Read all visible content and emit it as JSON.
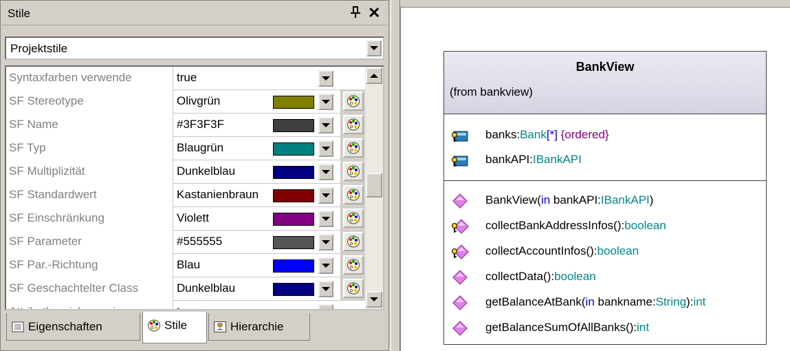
{
  "panel": {
    "title": "Stile",
    "pin_glyph": "Ԃ",
    "close_glyph": "✕",
    "style_scope": "Projektstile"
  },
  "properties": [
    {
      "name": "Syntaxfarben verwende",
      "value": "true",
      "color": null
    },
    {
      "name": "SF Stereotype",
      "value": "Olivgrün",
      "color": "#808000"
    },
    {
      "name": "SF Name",
      "value": "#3F3F3F",
      "color": "#3f3f3f"
    },
    {
      "name": "SF Typ",
      "value": "Blaugrün",
      "color": "#008080"
    },
    {
      "name": "SF Multiplizität",
      "value": "Dunkelblau",
      "color": "#000080"
    },
    {
      "name": "SF Standardwert",
      "value": "Kastanienbraun",
      "color": "#800000"
    },
    {
      "name": "SF Einschränkung",
      "value": "Violett",
      "color": "#800080"
    },
    {
      "name": "SF Parameter",
      "value": "#555555",
      "color": "#555555"
    },
    {
      "name": "SF Par.-Richtung",
      "value": "Blau",
      "color": "#0000ff"
    },
    {
      "name": "SF Geschachtelter Class",
      "value": "Dunkelblau",
      "color": "#000080"
    },
    {
      "name": "Attributbereich anzeigen",
      "value": "true",
      "color": null
    }
  ],
  "tabs": [
    {
      "label": "Eigenschaften",
      "icon": "properties-icon",
      "active": false
    },
    {
      "label": "Stile",
      "icon": "palette-icon",
      "active": true
    },
    {
      "label": "Hierarchie",
      "icon": "hierarchy-icon",
      "active": false
    }
  ],
  "diagram": {
    "class_name": "BankView",
    "from_text": "(from bankview)",
    "attributes": [
      {
        "icon": "protected-attribute-icon",
        "parts": [
          [
            "banks:",
            ""
          ],
          [
            "Bank",
            "ty"
          ],
          [
            "[*]",
            "kw"
          ],
          [
            "  {ordered}",
            "co"
          ]
        ]
      },
      {
        "icon": "protected-attribute-icon",
        "parts": [
          [
            "bankAPI:",
            ""
          ],
          [
            "IBankAPI",
            "ty"
          ]
        ]
      }
    ],
    "operations": [
      {
        "icon": "public-operation-icon",
        "parts": [
          [
            "BankView(",
            ""
          ],
          [
            "in",
            "kw"
          ],
          [
            " bankAPI:",
            ""
          ],
          [
            "IBankAPI",
            "ty"
          ],
          [
            ")",
            ""
          ]
        ]
      },
      {
        "icon": "protected-operation-icon",
        "parts": [
          [
            "collectBankAddressInfos():",
            ""
          ],
          [
            "boolean",
            "ty"
          ]
        ]
      },
      {
        "icon": "protected-operation-icon",
        "parts": [
          [
            "collectAccountInfos():",
            ""
          ],
          [
            "boolean",
            "ty"
          ]
        ]
      },
      {
        "icon": "public-operation-icon",
        "parts": [
          [
            "collectData():",
            ""
          ],
          [
            "boolean",
            "ty"
          ]
        ]
      },
      {
        "icon": "public-operation-icon",
        "parts": [
          [
            "getBalanceAtBank(",
            ""
          ],
          [
            "in",
            "kw"
          ],
          [
            " bankname:",
            ""
          ],
          [
            "String",
            "ty"
          ],
          [
            "):",
            ""
          ],
          [
            "int",
            "ty"
          ]
        ]
      },
      {
        "icon": "public-operation-icon",
        "parts": [
          [
            "getBalanceSumOfAllBanks():",
            ""
          ],
          [
            "int",
            "ty"
          ]
        ]
      }
    ]
  }
}
